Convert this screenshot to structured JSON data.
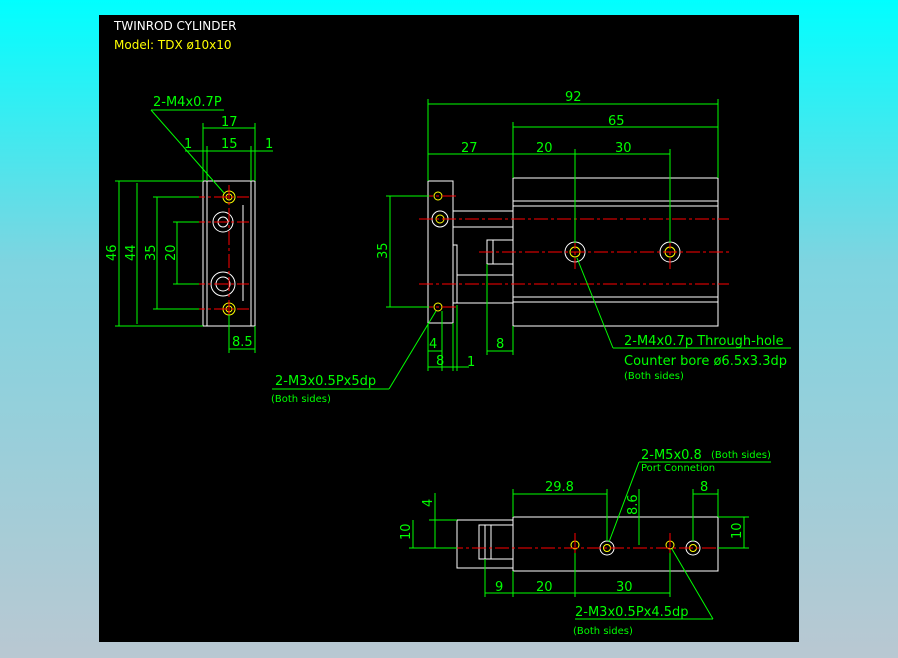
{
  "header": {
    "title": "TWINROD CYLINDER",
    "model": "Model: TDX  ø10x10"
  },
  "colors": {
    "background": "#000000",
    "outline": "#ffffff",
    "dimension": "#00ff00",
    "centerline": "#ff0000",
    "hole_detail": "#ffff00",
    "page_gradient_top": "#00ffff",
    "page_gradient_bottom": "#b9c8d2"
  },
  "side_view": {
    "thread_label": "2-M4x0.7P",
    "dims": {
      "w17": "17",
      "w15": "15",
      "gap_left": "1",
      "gap_right": "1",
      "h46": "46",
      "h44": "44",
      "h35": "35",
      "h20": "20",
      "w85": "8.5"
    }
  },
  "front_view": {
    "dims": {
      "len92": "92",
      "len65": "65",
      "len27": "27",
      "len20": "20",
      "len30": "30",
      "h35": "35",
      "w4": "4",
      "w8a": "8",
      "w8b": "8",
      "w1": "1"
    },
    "note_through_hole": "2-M4x0.7p Through-hole",
    "note_counter_bore": "Counter bore ø6.5x3.3dp",
    "note_counter_sides": "(Both sides)",
    "note_m3": "2-M3x0.5Px5dp",
    "note_m3_sides": "(Both sides)"
  },
  "bottom_view": {
    "dims": {
      "v4": "4",
      "v10_left": "10",
      "len298": "29.8",
      "v86": "8.6",
      "w8": "8",
      "v10_right": "10",
      "w9": "9",
      "len20": "20",
      "len30": "30"
    },
    "note_m5": "2-M5x0.8",
    "note_m5_sides": "(Both sides)",
    "note_port": "Port Connetion",
    "note_m3": "2-M3x0.5Px4.5dp",
    "note_m3_sides": "(Both sides)"
  }
}
